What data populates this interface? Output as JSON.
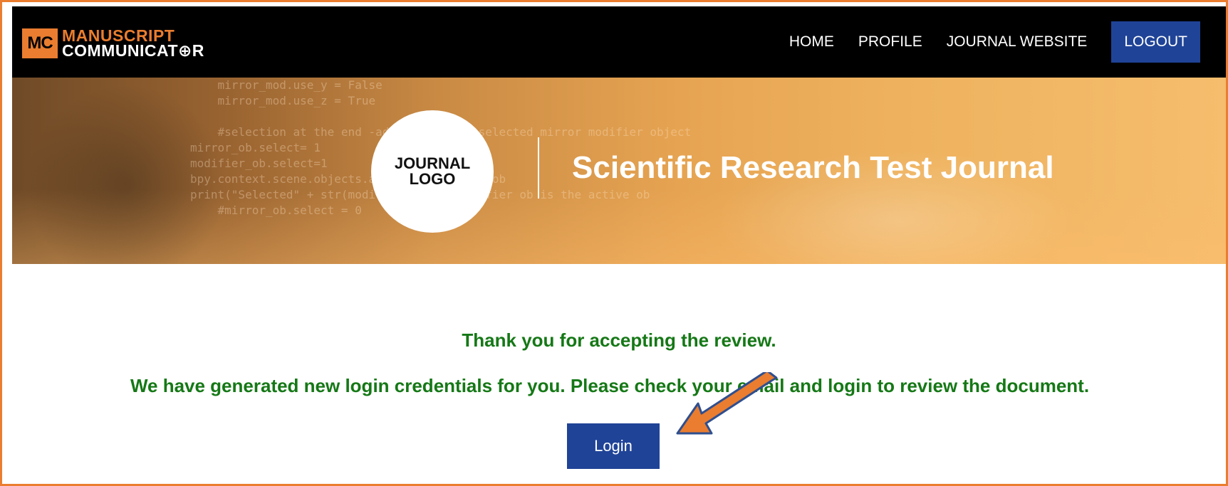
{
  "header": {
    "logo_mark": "MC",
    "logo_line1": "MANUSCRIPT",
    "logo_line2": "COMMUNICAT⊕R",
    "nav": [
      "HOME",
      "PROFILE",
      "JOURNAL WEBSITE"
    ],
    "logout_label": "LOGOUT"
  },
  "banner": {
    "journal_logo_line1": "JOURNAL",
    "journal_logo_line2": "LOGO",
    "journal_title": "Scientific Research Test Journal"
  },
  "main": {
    "message_title": "Thank you for accepting the review.",
    "message_body": "We have generated new login credentials for you. Please check your email and login to review the document.",
    "login_label": "Login"
  },
  "colors": {
    "accent_orange": "#ea7d2f",
    "button_blue": "#1f4397",
    "message_green": "#157816"
  }
}
